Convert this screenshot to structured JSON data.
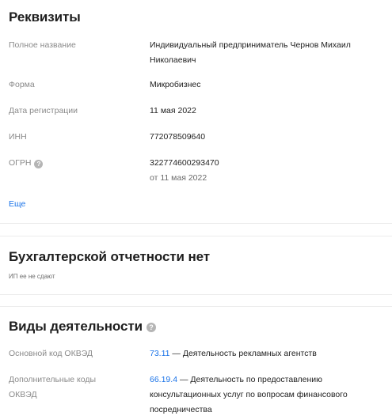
{
  "requisites": {
    "title": "Реквизиты",
    "rows": [
      {
        "label": "Полное название",
        "value": "Индивидуальный предприниматель Чернов Михаил Николаевич"
      },
      {
        "label": "Форма",
        "value": "Микробизнес"
      },
      {
        "label": "Дата регистрации",
        "value": "11 мая 2022"
      },
      {
        "label": "ИНН",
        "value": "772078509640"
      },
      {
        "label": "ОГРН",
        "value": "322774600293470",
        "sub": "от 11 мая 2022"
      }
    ],
    "more_link": "Еще"
  },
  "accounting": {
    "title": "Бухгалтерской отчетности нет",
    "note": "ИП ее не сдают"
  },
  "activities": {
    "title": "Виды деятельности",
    "main_label": "Основной код ОКВЭД",
    "main_code": "73.11",
    "main_desc": " — Деятельность рекламных агентств",
    "extra_label": "Дополнительные коды ОКВЭД",
    "extra_code": "66.19.4",
    "extra_desc": " — Деятельность по предоставлению консультационных услуг по вопросам финансового посредничества"
  },
  "icons": {
    "help": "question-circle-icon"
  },
  "colors": {
    "link": "#1a73e8",
    "label": "#8a8a8a",
    "divider": "#ececec"
  }
}
